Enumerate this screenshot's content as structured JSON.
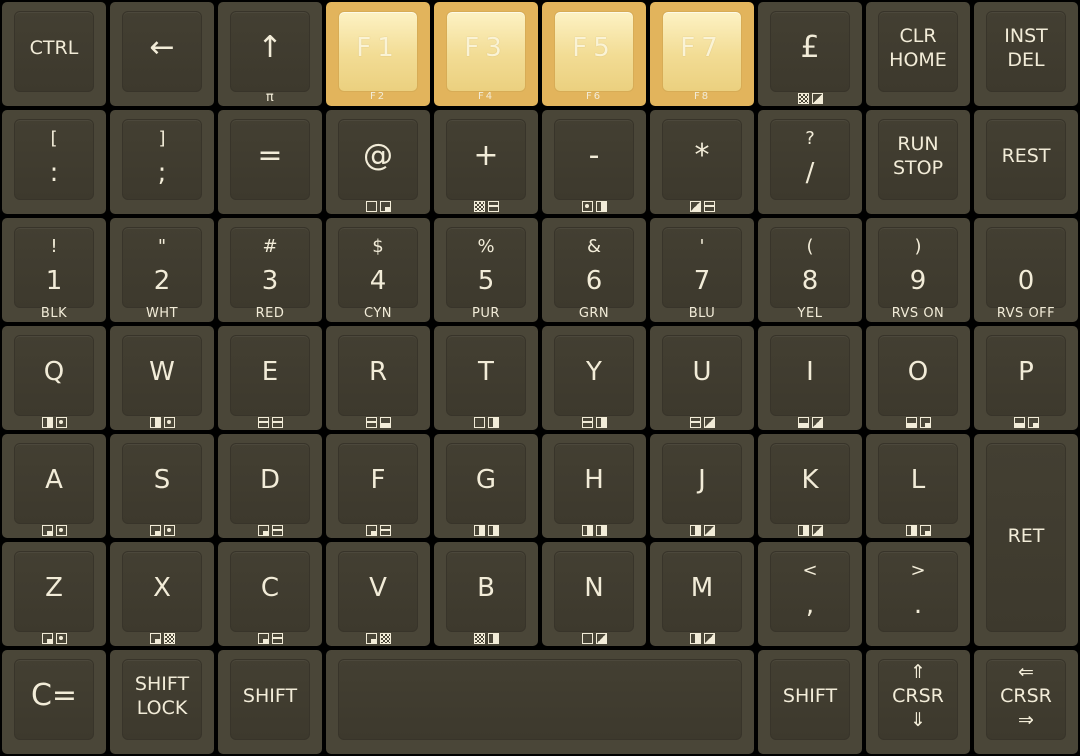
{
  "keyboard": {
    "rows": [
      [
        {
          "name": "ctrl",
          "labels": [
            "CTRL"
          ],
          "style": "word"
        },
        {
          "name": "left-arrow",
          "labels": [
            "←"
          ],
          "style": "big"
        },
        {
          "name": "up-arrow",
          "labels": [
            "↑"
          ],
          "sub": "π",
          "style": "big"
        },
        {
          "name": "f1",
          "labels": [
            "F1"
          ],
          "sub": "F2",
          "fkey": true
        },
        {
          "name": "f3",
          "labels": [
            "F3"
          ],
          "sub": "F4",
          "fkey": true
        },
        {
          "name": "f5",
          "labels": [
            "F5"
          ],
          "sub": "F6",
          "fkey": true
        },
        {
          "name": "f7",
          "labels": [
            "F7"
          ],
          "sub": "F8",
          "fkey": true
        },
        {
          "name": "pound",
          "labels": [
            "£"
          ],
          "glyphs": [
            "check",
            "diag"
          ],
          "style": "big"
        },
        {
          "name": "clr-home",
          "labels": [
            "CLR",
            "HOME"
          ],
          "style": "word"
        },
        {
          "name": "inst-del",
          "labels": [
            "INST",
            "DEL"
          ],
          "style": "word"
        }
      ],
      [
        {
          "name": "bracket-open",
          "labels": [
            "[",
            ":"
          ],
          "style": "sm"
        },
        {
          "name": "bracket-close",
          "labels": [
            "]",
            ";"
          ],
          "style": "sm"
        },
        {
          "name": "equals",
          "labels": [
            "="
          ],
          "style": "big"
        },
        {
          "name": "at",
          "labels": [
            "@"
          ],
          "glyphs": [
            "plain",
            "quad"
          ],
          "style": "big"
        },
        {
          "name": "plus",
          "labels": [
            "+"
          ],
          "glyphs": [
            "check",
            "line"
          ],
          "style": "big"
        },
        {
          "name": "minus",
          "labels": [
            "-"
          ],
          "glyphs": [
            "dot",
            "half-r"
          ],
          "style": "big"
        },
        {
          "name": "asterisk",
          "labels": [
            "*"
          ],
          "glyphs": [
            "diag",
            "line"
          ],
          "style": "big"
        },
        {
          "name": "question-slash",
          "labels": [
            "?",
            "/"
          ],
          "style": "sm"
        },
        {
          "name": "run-stop",
          "labels": [
            "RUN",
            "STOP"
          ],
          "style": "word"
        },
        {
          "name": "restore",
          "labels": [
            "REST"
          ],
          "style": "word"
        }
      ],
      [
        {
          "name": "key-1",
          "labels": [
            "!",
            "1"
          ],
          "sub": "BLK",
          "style": "sm"
        },
        {
          "name": "key-2",
          "labels": [
            "\"",
            "2"
          ],
          "sub": "WHT",
          "style": "sm"
        },
        {
          "name": "key-3",
          "labels": [
            "#",
            "3"
          ],
          "sub": "RED",
          "style": "sm"
        },
        {
          "name": "key-4",
          "labels": [
            "$",
            "4"
          ],
          "sub": "CYN",
          "style": "sm"
        },
        {
          "name": "key-5",
          "labels": [
            "%",
            "5"
          ],
          "sub": "PUR",
          "style": "sm"
        },
        {
          "name": "key-6",
          "labels": [
            "&",
            "6"
          ],
          "sub": "GRN",
          "style": "sm"
        },
        {
          "name": "key-7",
          "labels": [
            "'",
            "7"
          ],
          "sub": "BLU",
          "style": "sm"
        },
        {
          "name": "key-8",
          "labels": [
            "(",
            "8"
          ],
          "sub": "YEL",
          "style": "sm"
        },
        {
          "name": "key-9",
          "labels": [
            ")",
            "9"
          ],
          "sub": "RVS ON",
          "style": "sm"
        },
        {
          "name": "key-0",
          "labels": [
            "",
            "0"
          ],
          "sub": "RVS OFF",
          "style": "sm"
        }
      ],
      [
        {
          "name": "q",
          "labels": [
            "Q"
          ],
          "glyphs": [
            "half-r",
            "dot"
          ]
        },
        {
          "name": "w",
          "labels": [
            "W"
          ],
          "glyphs": [
            "half-r",
            "dot"
          ]
        },
        {
          "name": "e",
          "labels": [
            "E"
          ],
          "glyphs": [
            "line",
            "line"
          ]
        },
        {
          "name": "r",
          "labels": [
            "R"
          ],
          "glyphs": [
            "line",
            "half-b"
          ]
        },
        {
          "name": "t",
          "labels": [
            "T"
          ],
          "glyphs": [
            "plain",
            "half-r"
          ]
        },
        {
          "name": "y",
          "labels": [
            "Y"
          ],
          "glyphs": [
            "line",
            "half-r"
          ]
        },
        {
          "name": "u",
          "labels": [
            "U"
          ],
          "glyphs": [
            "line",
            "diag"
          ]
        },
        {
          "name": "i",
          "labels": [
            "I"
          ],
          "glyphs": [
            "half-b",
            "diag"
          ]
        },
        {
          "name": "o",
          "labels": [
            "O"
          ],
          "glyphs": [
            "half-b",
            "quad"
          ]
        },
        {
          "name": "p",
          "labels": [
            "P"
          ],
          "glyphs": [
            "half-b",
            "quad"
          ]
        }
      ],
      [
        {
          "name": "a",
          "labels": [
            "A"
          ],
          "glyphs": [
            "quad",
            "dot"
          ]
        },
        {
          "name": "s",
          "labels": [
            "S"
          ],
          "glyphs": [
            "quad",
            "dot"
          ]
        },
        {
          "name": "d",
          "labels": [
            "D"
          ],
          "glyphs": [
            "quad",
            "line"
          ]
        },
        {
          "name": "f",
          "labels": [
            "F"
          ],
          "glyphs": [
            "quad",
            "line"
          ]
        },
        {
          "name": "g",
          "labels": [
            "G"
          ],
          "glyphs": [
            "half-r",
            "half-r"
          ]
        },
        {
          "name": "h",
          "labels": [
            "H"
          ],
          "glyphs": [
            "half-r",
            "half-r"
          ]
        },
        {
          "name": "j",
          "labels": [
            "J"
          ],
          "glyphs": [
            "half-r",
            "diag"
          ]
        },
        {
          "name": "k",
          "labels": [
            "K"
          ],
          "glyphs": [
            "half-r",
            "diag"
          ]
        },
        {
          "name": "l",
          "labels": [
            "L"
          ],
          "glyphs": [
            "half-r",
            "quad"
          ]
        },
        {
          "name": "return",
          "labels": [
            "RET"
          ],
          "style": "word",
          "tall": true
        }
      ],
      [
        {
          "name": "z",
          "labels": [
            "Z"
          ],
          "glyphs": [
            "quad",
            "dot"
          ]
        },
        {
          "name": "x",
          "labels": [
            "X"
          ],
          "glyphs": [
            "quad",
            "check"
          ]
        },
        {
          "name": "c",
          "labels": [
            "C"
          ],
          "glyphs": [
            "quad",
            "line"
          ]
        },
        {
          "name": "v",
          "labels": [
            "V"
          ],
          "glyphs": [
            "quad",
            "check"
          ]
        },
        {
          "name": "b",
          "labels": [
            "B"
          ],
          "glyphs": [
            "check",
            "half-r"
          ]
        },
        {
          "name": "n",
          "labels": [
            "N"
          ],
          "glyphs": [
            "plain",
            "diag"
          ]
        },
        {
          "name": "m",
          "labels": [
            "M"
          ],
          "glyphs": [
            "half-r",
            "diag"
          ]
        },
        {
          "name": "less-comma",
          "labels": [
            "<",
            ","
          ],
          "style": "sm"
        },
        {
          "name": "greater-period",
          "labels": [
            ">",
            "."
          ],
          "style": "sm"
        }
      ],
      [
        {
          "name": "commodore",
          "labels": [
            "C="
          ],
          "style": "big"
        },
        {
          "name": "shift-lock",
          "labels": [
            "SHIFT",
            "LOCK"
          ],
          "style": "word"
        },
        {
          "name": "shift-left",
          "labels": [
            "SHIFT"
          ],
          "style": "word"
        },
        {
          "name": "space",
          "labels": [],
          "span": 4
        },
        {
          "name": "shift-right",
          "labels": [
            "SHIFT"
          ],
          "style": "word"
        },
        {
          "name": "crsr-up-down",
          "labels": [
            "⇑",
            "CRSR",
            "⇓"
          ],
          "style": "word"
        },
        {
          "name": "crsr-left-right",
          "labels": [
            "⇐",
            "CRSR",
            "⇒"
          ],
          "style": "word"
        }
      ]
    ]
  }
}
